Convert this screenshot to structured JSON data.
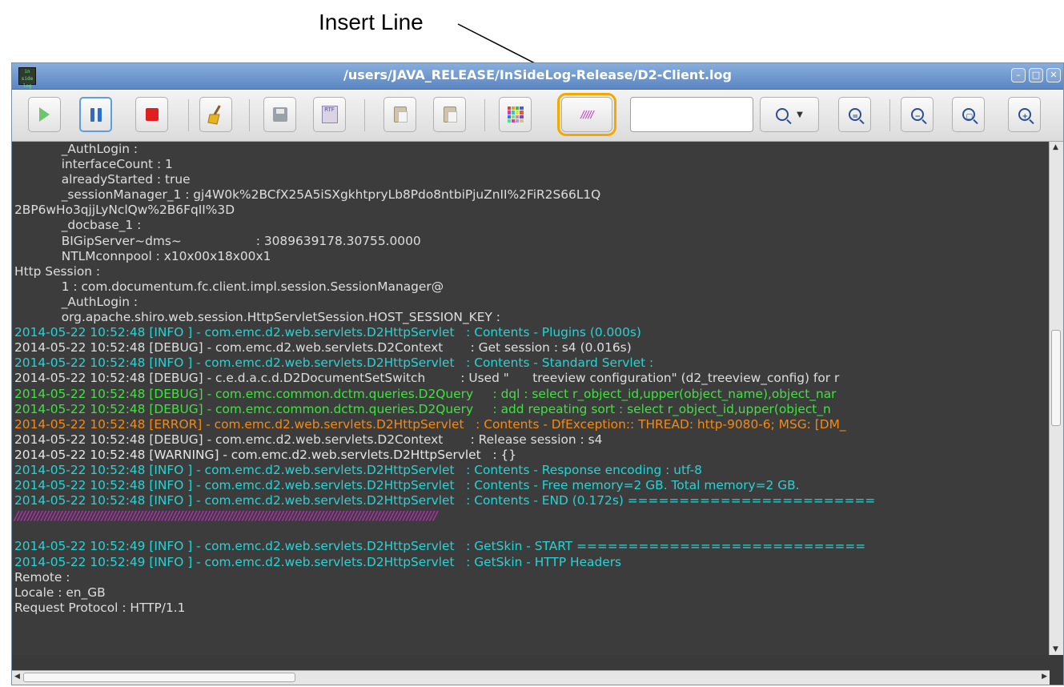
{
  "callout": {
    "label": "Insert Line"
  },
  "window": {
    "title": "/users/JAVA_RELEASE/InSideLog-Release/D2-Client.log",
    "app_icon_text": "in side log"
  },
  "toolbar": {
    "rtf_label": "RTF",
    "insert_line_glyph": "/////",
    "search_value": "",
    "search_placeholder": ""
  },
  "colors": {
    "info": "#27d3d3",
    "debug": "#dedede",
    "debug_query": "#43e043",
    "error": "#f48a14",
    "insert_line": "#c42fc4",
    "highlight": "#f5a900"
  },
  "log_lines": [
    "            _AuthLogin :",
    "            interfaceCount : 1",
    "            alreadyStarted : true",
    "            _sessionManager_1 : gj4W0k%2BCfX25A5iSXgkhtpryLb8Pdo8ntbiPjuZnII%2FiR2S66L1Q",
    "2BP6wHo3qjjLyNclQw%2B6FqII%3D",
    "            _docbase_1 :",
    "            BIGipServer~dms~                   : 3089639178.30755.0000",
    "            NTLMconnpool : x10x00x18x00x1",
    "Http Session :",
    "            1 : com.documentum.fc.client.impl.session.SessionManager@",
    "            _AuthLogin :",
    "            org.apache.shiro.web.session.HttpServletSession.HOST_SESSION_KEY :",
    "2014-05-22 10:52:48 [INFO ] - com.emc.d2.web.servlets.D2HttpServlet   : Contents - Plugins (0.000s)",
    "2014-05-22 10:52:48 [DEBUG] - com.emc.d2.web.servlets.D2Context       : Get session : s4 (0.016s)",
    "2014-05-22 10:52:48 [INFO ] - com.emc.d2.web.servlets.D2HttpServlet   : Contents - Standard Servlet :",
    "2014-05-22 10:52:48 [DEBUG] - c.e.d.a.c.d.D2DocumentSetSwitch         : Used \"      treeview configuration\" (d2_treeview_config) for r",
    "2014-05-22 10:52:48 [DEBUG] - com.emc.common.dctm.queries.D2Query     : dql : select r_object_id,upper(object_name),object_nar",
    "2014-05-22 10:52:48 [DEBUG] - com.emc.common.dctm.queries.D2Query     : add repeating sort : select r_object_id,upper(object_n",
    "2014-05-22 10:52:48 [ERROR] - com.emc.d2.web.servlets.D2HttpServlet   : Contents - DfException:: THREAD: http-9080-6; MSG: [DM_",
    "2014-05-22 10:52:48 [DEBUG] - com.emc.d2.web.servlets.D2Context       : Release session : s4",
    "2014-05-22 10:52:48 [WARNING] - com.emc.d2.web.servlets.D2HttpServlet   : {}",
    "2014-05-22 10:52:48 [INFO ] - com.emc.d2.web.servlets.D2HttpServlet   : Contents - Response encoding : utf-8",
    "2014-05-22 10:52:48 [INFO ] - com.emc.d2.web.servlets.D2HttpServlet   : Contents - Free memory=2 GB. Total memory=2 GB.",
    "2014-05-22 10:52:48 [INFO ] - com.emc.d2.web.servlets.D2HttpServlet   : Contents - END (0.172s) ========================",
    "//////////////////////////////////////////////////////////////////////////////////////////////////////////////////////////////",
    "",
    "2014-05-22 10:52:49 [INFO ] - com.emc.d2.web.servlets.D2HttpServlet   : GetSkin - START ============================",
    "2014-05-22 10:52:49 [INFO ] - com.emc.d2.web.servlets.D2HttpServlet   : GetSkin - HTTP Headers",
    "Remote :",
    "Locale : en_GB",
    "Request Protocol : HTTP/1.1"
  ],
  "log_line_types": [
    "debug",
    "debug",
    "debug",
    "debug",
    "debug",
    "debug",
    "debug",
    "debug",
    "debug",
    "debug",
    "debug",
    "debug",
    "info",
    "debug",
    "info",
    "debug",
    "dq",
    "dq",
    "err",
    "debug",
    "warn",
    "info",
    "info",
    "info",
    "line",
    "debug",
    "info",
    "info",
    "debug",
    "debug",
    "debug"
  ]
}
